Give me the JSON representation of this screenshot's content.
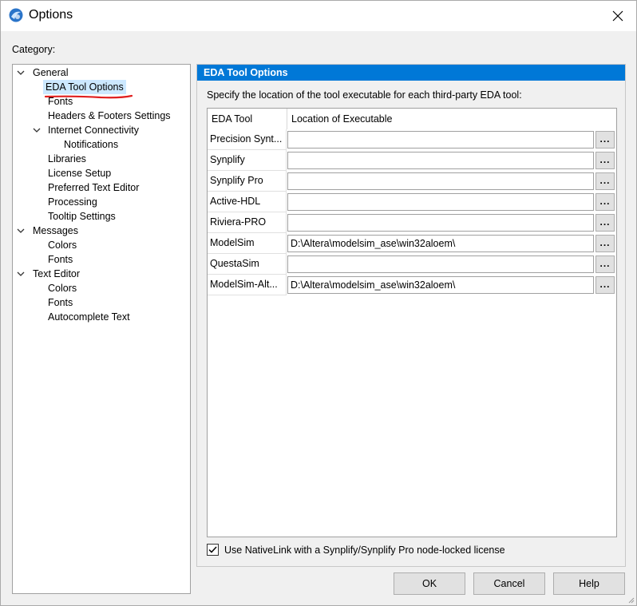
{
  "window": {
    "title": "Options"
  },
  "category_label": "Category:",
  "tree": [
    {
      "label": "General",
      "expandable": true
    },
    {
      "label": "EDA Tool Options",
      "selected": true
    },
    {
      "label": "Fonts"
    },
    {
      "label": "Headers & Footers Settings"
    },
    {
      "label": "Internet Connectivity",
      "expandable": true
    },
    {
      "label": "Notifications"
    },
    {
      "label": "Libraries"
    },
    {
      "label": "License Setup"
    },
    {
      "label": "Preferred Text Editor"
    },
    {
      "label": "Processing"
    },
    {
      "label": "Tooltip Settings"
    },
    {
      "label": "Messages",
      "expandable": true
    },
    {
      "label": "Colors"
    },
    {
      "label": "Fonts"
    },
    {
      "label": "Text Editor",
      "expandable": true
    },
    {
      "label": "Colors"
    },
    {
      "label": "Fonts"
    },
    {
      "label": "Autocomplete Text"
    }
  ],
  "panel": {
    "header": "EDA Tool Options",
    "description": "Specify the location of the tool executable for each third-party EDA tool:",
    "columns": [
      "EDA Tool",
      "Location of Executable"
    ],
    "rows": [
      {
        "tool": "Precision Synt...",
        "path": ""
      },
      {
        "tool": "Synplify",
        "path": ""
      },
      {
        "tool": "Synplify Pro",
        "path": ""
      },
      {
        "tool": "Active-HDL",
        "path": ""
      },
      {
        "tool": "Riviera-PRO",
        "path": ""
      },
      {
        "tool": "ModelSim",
        "path": "D:\\Altera\\modelsim_ase\\win32aloem\\"
      },
      {
        "tool": "QuestaSim",
        "path": ""
      },
      {
        "tool": "ModelSim-Alt...",
        "path": "D:\\Altera\\modelsim_ase\\win32aloem\\"
      }
    ],
    "browse_label": "...",
    "checkbox_label": "Use NativeLink with a Synplify/Synplify Pro node-locked license",
    "checkbox_checked": true
  },
  "buttons": {
    "ok": "OK",
    "cancel": "Cancel",
    "help": "Help"
  },
  "colors": {
    "header_blue": "#0078d7",
    "selection": "#cce8ff",
    "annotation_red": "#e02020"
  }
}
